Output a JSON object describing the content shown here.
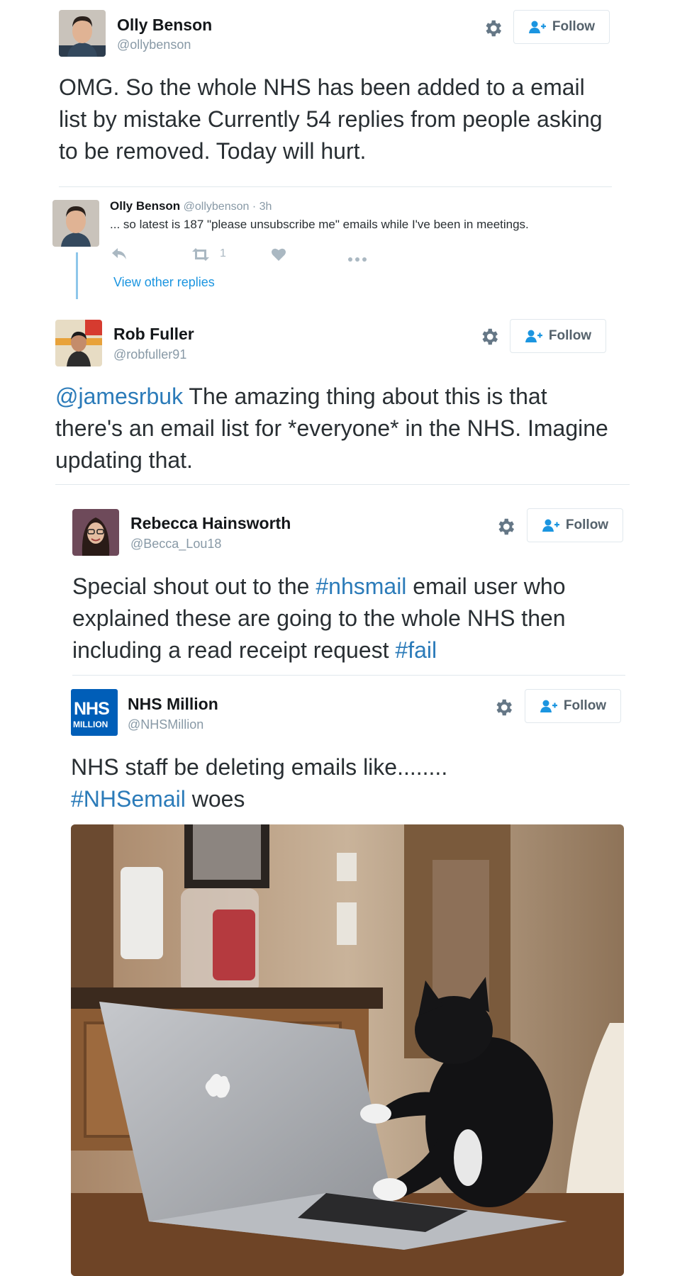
{
  "tweets": [
    {
      "name": "Olly Benson",
      "handle": "@ollybenson",
      "follow_label": "Follow",
      "text": "OMG. So the whole NHS has been added to a email list by mistake Currently 54 replies from people asking to be removed. Today will hurt."
    },
    {
      "name": "Rob Fuller",
      "handle": "@robfuller91",
      "follow_label": "Follow",
      "text_mention": "@jamesrbuk",
      "text_rest": " The amazing thing about this is that there's an email list for *everyone* in the NHS. Imagine updating that."
    },
    {
      "name": "Rebecca Hainsworth",
      "handle": "@Becca_Lou18",
      "follow_label": "Follow",
      "text_a": "Special shout out to the ",
      "text_tag1": "#nhsmail",
      "text_b": " email user who explained these are going to the whole NHS then including a read receipt request ",
      "text_tag2": "#fail"
    },
    {
      "name": "NHS Million",
      "handle": "@NHSMillion",
      "follow_label": "Follow",
      "avatar_text_top": "NHS",
      "avatar_text_bottom": "MILLION",
      "text_line1": "NHS staff be deleting emails like........",
      "text_tag": "#NHSemail",
      "text_rest": " woes"
    }
  ],
  "reply": {
    "name": "Olly Benson",
    "handle": "@ollybenson",
    "time": "· 3h",
    "text": "... so latest is 187 \"please unsubscribe me\" emails while I've been in meetings.",
    "retweet_count": "1",
    "view_replies": "View other replies"
  },
  "colors": {
    "link": "#1b95e0",
    "hashtag": "#2b7bb9",
    "nhs_blue": "#005eb8"
  },
  "icons": [
    "gear-icon",
    "follow-user-icon",
    "reply-icon",
    "retweet-icon",
    "like-icon",
    "more-icon"
  ]
}
